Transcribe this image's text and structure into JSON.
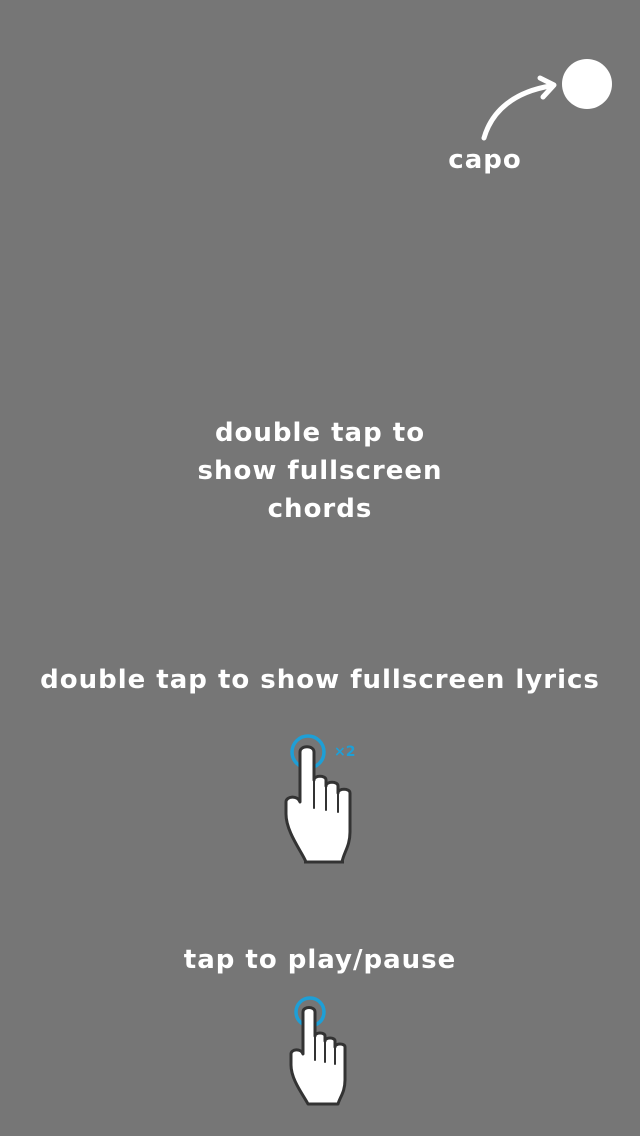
{
  "capo": {
    "label": "capo",
    "icon": "capo-dot-icon",
    "arrow_icon": "curved-arrow-icon"
  },
  "hints": {
    "chords": "double tap to\nshow fullscreen\nchords",
    "lyrics": "double tap to show fullscreen lyrics",
    "play": "tap to play/pause"
  },
  "gestures": {
    "double_tap_icon": "double-tap-hand-icon",
    "double_tap_badge": "×2",
    "single_tap_icon": "tap-hand-icon"
  },
  "colors": {
    "background": "#767676",
    "text": "#ffffff",
    "accent": "#1e9fd6"
  }
}
